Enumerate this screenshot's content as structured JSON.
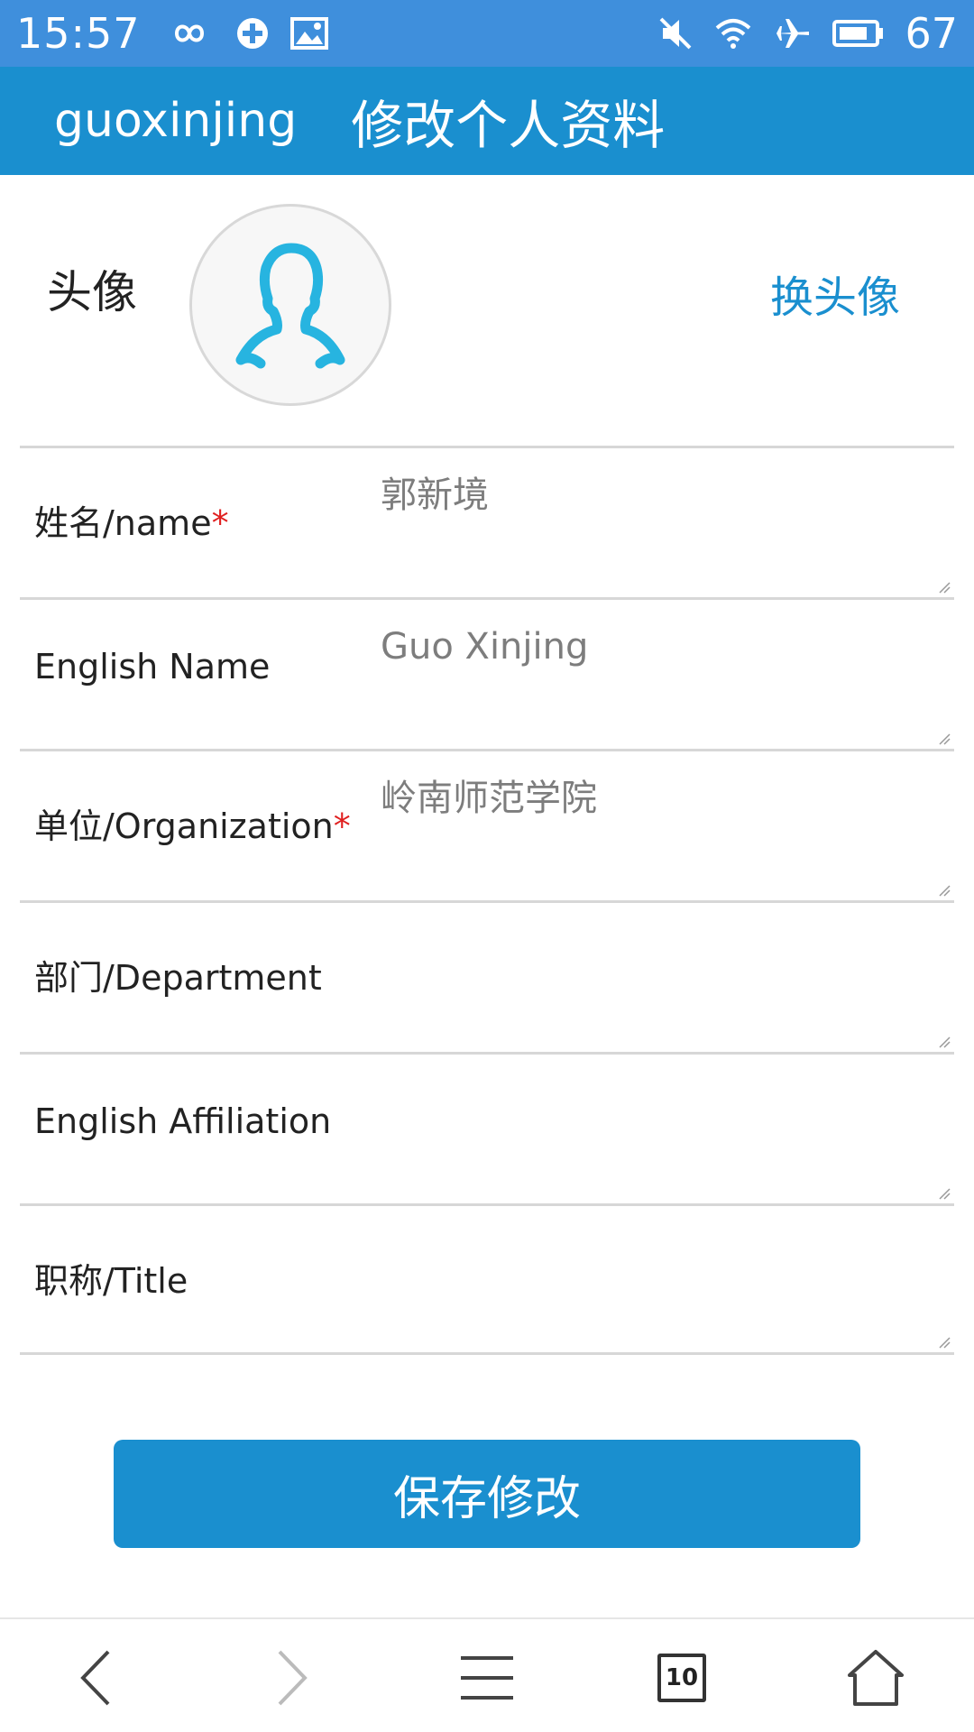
{
  "status_bar": {
    "time": "15:57",
    "left_icons": [
      "infinity-icon",
      "sync-icon",
      "image-icon"
    ],
    "right_icons": [
      "mute-icon",
      "wifi-icon",
      "airplane-icon",
      "battery-icon"
    ],
    "battery": "67"
  },
  "header": {
    "username": "guoxinjing",
    "title": "修改个人资料"
  },
  "avatar": {
    "label": "头像",
    "change_label": "换头像"
  },
  "form": {
    "fields": [
      {
        "label": "姓名/name",
        "required": "*",
        "value": "郭新境"
      },
      {
        "label": "English Name",
        "required": "",
        "value": "Guo Xinjing"
      },
      {
        "label": "单位/Organization",
        "required": "*",
        "value": "岭南师范学院"
      },
      {
        "label": "部门/Department",
        "required": "",
        "value": ""
      },
      {
        "label": "English Affiliation",
        "required": "",
        "value": ""
      },
      {
        "label": "职称/Title",
        "required": "",
        "value": ""
      }
    ],
    "save_label": "保存修改"
  },
  "bottom_nav": {
    "tab_count": "10",
    "icons": [
      "back-icon",
      "forward-icon",
      "menu-icon",
      "tabs-icon",
      "home-icon"
    ]
  },
  "colors": {
    "status_bar": "#3f8fdc",
    "accent": "#1a8fcf",
    "required": "#e02020"
  }
}
